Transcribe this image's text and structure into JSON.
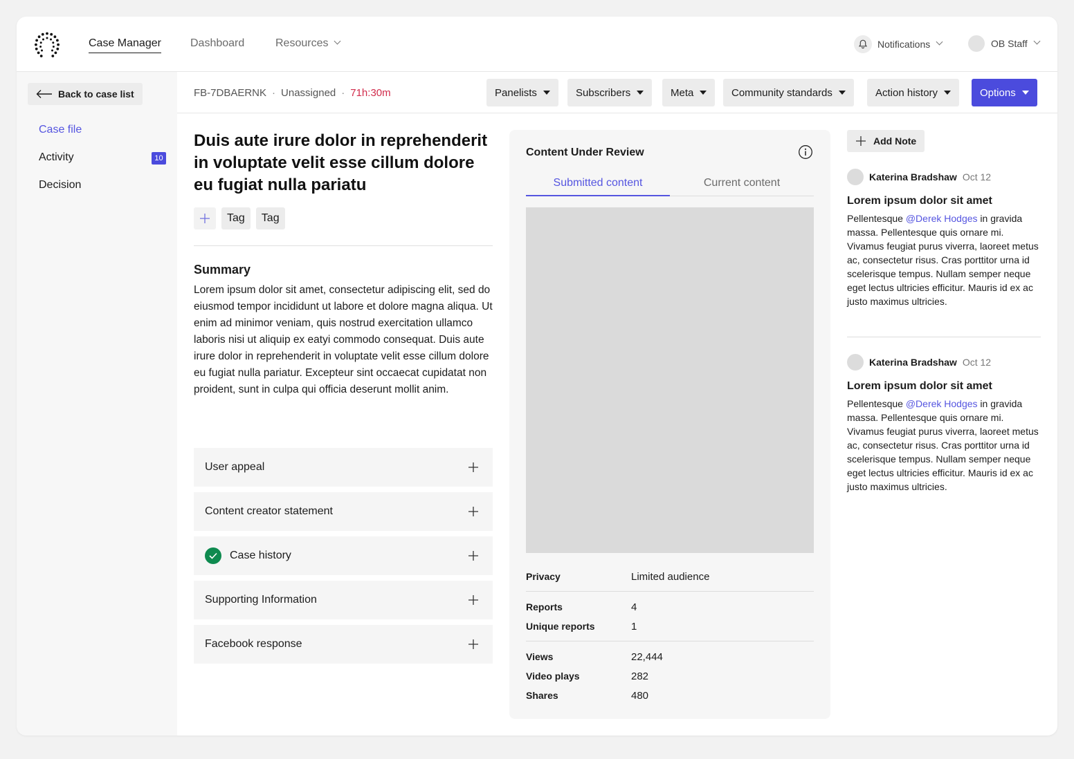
{
  "nav": {
    "links": [
      "Case Manager",
      "Dashboard",
      "Resources"
    ],
    "notifications_label": "Notifications",
    "user_label": "OB Staff"
  },
  "sidebar": {
    "back_label": "Back to case list",
    "items": [
      {
        "label": "Case file"
      },
      {
        "label": "Activity",
        "badge": "10"
      },
      {
        "label": "Decision"
      }
    ]
  },
  "subheader": {
    "case_id": "FB-7DBAERNK",
    "assignee": "Unassigned",
    "timer": "71h:30m",
    "buttons": [
      "Panelists",
      "Subscribers",
      "Meta",
      "Community standards",
      "Action history",
      "Options"
    ]
  },
  "main": {
    "title": "Duis aute irure dolor in reprehenderit in voluptate velit esse cillum dolore eu fugiat nulla pariatu",
    "tags": [
      "Tag",
      "Tag"
    ],
    "summary_heading": "Summary",
    "summary_text": "Lorem ipsum dolor sit amet, consectetur adipiscing elit, sed do eiusmod tempor incididunt ut labore et dolore magna aliqua. Ut enim ad minimor veniam, quis nostrud exercitation ullamco laboris nisi ut aliquip ex eatyi commodo consequat. Duis aute irure dolor in reprehenderit in voluptate velit esse cillum dolore eu fugiat nulla pariatur. Excepteur sint occaecat cupidatat non proident, sunt in culpa qui officia deserunt mollit anim.",
    "sections": [
      "User appeal",
      "Content creator statement",
      "Case history",
      "Supporting Information",
      "Facebook response"
    ]
  },
  "review": {
    "title": "Content Under Review",
    "tabs": [
      "Submitted content",
      "Current content"
    ],
    "stats": [
      {
        "key": "Privacy",
        "value": "Limited audience"
      },
      {
        "key": "Reports",
        "value": "4"
      },
      {
        "key": "Unique reports",
        "value": "1"
      },
      {
        "key": "Views",
        "value": "22,444"
      },
      {
        "key": "Video plays",
        "value": "282"
      },
      {
        "key": "Shares",
        "value": "480"
      }
    ]
  },
  "notes": {
    "add_label": "Add Note",
    "items": [
      {
        "author": "Katerina Bradshaw",
        "date": "Oct 12",
        "title": "Lorem ipsum dolor sit amet",
        "body_before": "Pellentesque ",
        "mention": "@Derek Hodges",
        "body_after": " in gravida massa. Pellentesque quis ornare mi. Vivamus feugiat purus viverra, laoreet metus ac, consectetur risus. Cras porttitor urna id scelerisque tempus. Nullam semper neque eget lectus ultricies efficitur. Mauris id ex ac justo maximus ultricies."
      },
      {
        "author": "Katerina Bradshaw",
        "date": "Oct 12",
        "title": "Lorem ipsum dolor sit amet",
        "body_before": "Pellentesque ",
        "mention": "@Derek Hodges",
        "body_after": " in gravida massa. Pellentesque quis ornare mi. Vivamus feugiat purus viverra, laoreet metus ac, consectetur risus. Cras porttitor urna id scelerisque tempus. Nullam semper neque eget lectus ultricies efficitur. Mauris id ex ac justo maximus ultricies."
      }
    ]
  },
  "colors": {
    "accent": "#4b4bdd",
    "link": "#5555e0",
    "timer": "#d12b4b",
    "success": "#0e8a4f"
  },
  "icons": [
    "logo-icon",
    "chevron-down-icon",
    "bell-icon",
    "arrow-left-icon",
    "plus-icon",
    "check-icon",
    "info-icon",
    "caret-down-icon"
  ]
}
